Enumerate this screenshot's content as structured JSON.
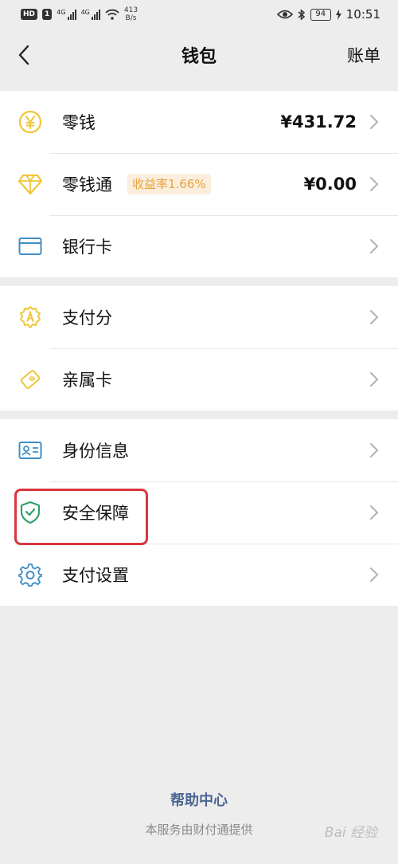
{
  "status_bar": {
    "hd": "HD",
    "sim1": "1",
    "net1": "4G",
    "net2": "4G",
    "speed_value": "413",
    "speed_unit": "B/s",
    "battery": "94",
    "time": "10:51"
  },
  "nav": {
    "title": "钱包",
    "right_link": "账单"
  },
  "groups": [
    {
      "items": [
        {
          "label": "零钱",
          "value": "¥431.72",
          "icon": "yuan-coin-icon"
        },
        {
          "label": "零钱通",
          "value": "¥0.00",
          "badge": "收益率1.66%",
          "icon": "diamond-icon"
        },
        {
          "label": "银行卡",
          "icon": "bank-card-icon"
        }
      ]
    },
    {
      "items": [
        {
          "label": "支付分",
          "icon": "pay-score-icon"
        },
        {
          "label": "亲属卡",
          "icon": "family-card-icon"
        }
      ]
    },
    {
      "items": [
        {
          "label": "身份信息",
          "icon": "id-card-icon"
        },
        {
          "label": "安全保障",
          "icon": "shield-check-icon"
        },
        {
          "label": "支付设置",
          "icon": "gear-icon"
        }
      ]
    }
  ],
  "footer": {
    "help": "帮助中心",
    "provider": "本服务由财付通提供",
    "watermark": "Bai 经验"
  },
  "colors": {
    "gold": "#f0c63a",
    "blue": "#3f8fc7",
    "green": "#2fa36b",
    "highlight": "#d9363e",
    "link": "#4a6592"
  }
}
